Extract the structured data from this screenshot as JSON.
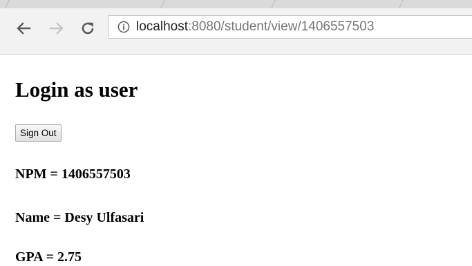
{
  "browser": {
    "url_host": "localhost",
    "url_path": ":8080/student/view/1406557503",
    "icons": {
      "back": "back-arrow-icon",
      "forward": "forward-arrow-icon",
      "reload": "reload-icon",
      "site_info": "info-icon"
    }
  },
  "page": {
    "title": "Login as user",
    "sign_out_label": "Sign Out",
    "npm_text": "NPM = 1406557503",
    "name_text": "Name = Desy Ulfasari",
    "gpa_text": "GPA = 2.75"
  }
}
